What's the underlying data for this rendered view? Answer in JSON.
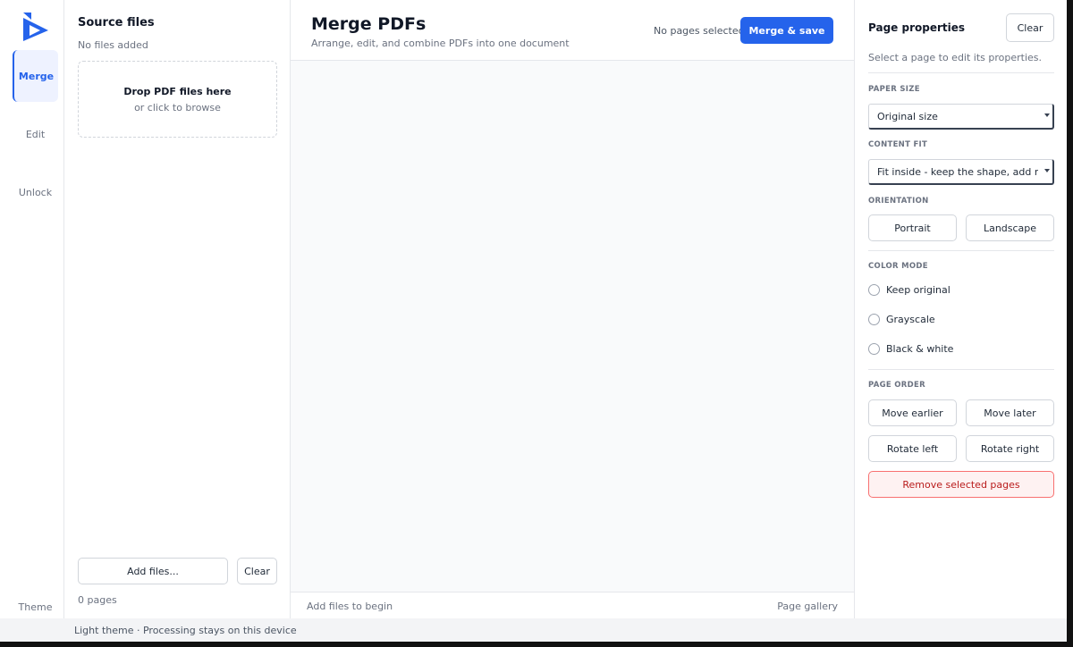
{
  "nav": {
    "items": [
      {
        "label": "Merge",
        "active": true
      },
      {
        "label": "Edit",
        "active": false
      },
      {
        "label": "Unlock",
        "active": false
      }
    ],
    "theme_label": "Theme"
  },
  "source": {
    "title": "Source files",
    "subtitle": "No files added",
    "drop_main": "Drop PDF files here",
    "drop_sub": "or click to browse",
    "add_button": "Add files...",
    "clear_button": "Clear",
    "page_count": "0 pages"
  },
  "header": {
    "title": "Merge PDFs",
    "subtitle": "Arrange, edit, and combine PDFs into one document",
    "selection_status": "No pages selected",
    "merge_button": "Merge & save"
  },
  "footer": {
    "left": "Add files to begin",
    "right": "Page gallery"
  },
  "properties": {
    "title": "Page properties",
    "clear_button": "Clear",
    "hint": "Select a page to edit its properties.",
    "paper_size": {
      "label": "PAPER SIZE",
      "value": "Original size"
    },
    "content_fit": {
      "label": "CONTENT FIT",
      "value": "Fit inside - keep the shape, add margins"
    },
    "orientation": {
      "label": "ORIENTATION",
      "portrait": "Portrait",
      "landscape": "Landscape"
    },
    "color_mode": {
      "label": "COLOR MODE",
      "options": [
        "Keep original",
        "Grayscale",
        "Black & white"
      ]
    },
    "page_order": {
      "label": "PAGE ORDER",
      "move_earlier": "Move earlier",
      "move_later": "Move later",
      "rotate_left": "Rotate left",
      "rotate_right": "Rotate right"
    },
    "remove_button": "Remove selected pages"
  },
  "statusbar": {
    "text": "Light theme · Processing stays on this device"
  },
  "colors": {
    "accent": "#2563eb",
    "danger": "#b91c1c",
    "danger_bg": "#fef2f2"
  }
}
